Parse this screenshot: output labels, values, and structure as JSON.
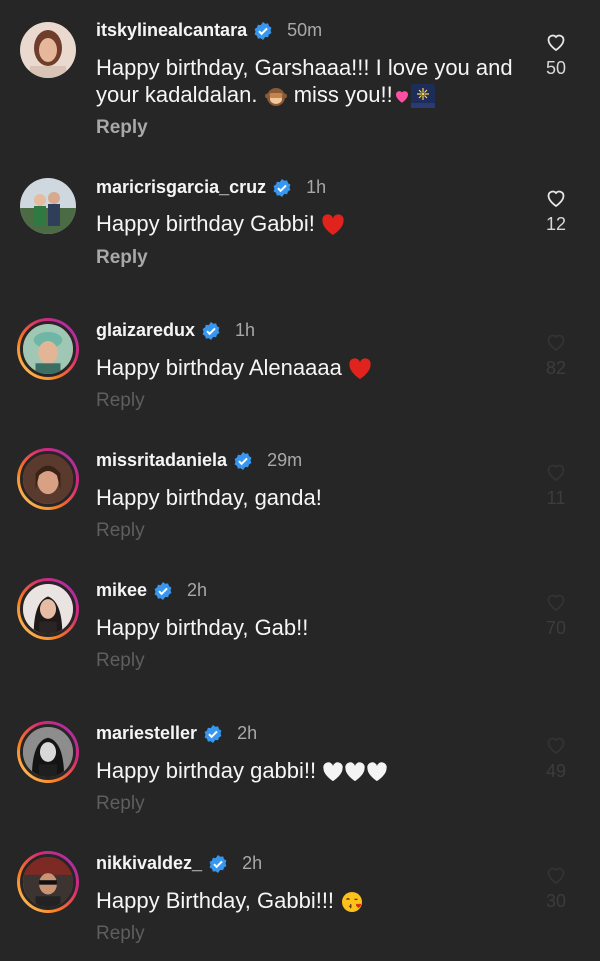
{
  "colors": {
    "background": "#262626",
    "verified": "#3797f0",
    "heart_red": "#e0241d"
  },
  "comments": [
    {
      "username": "itskylinealcantara",
      "time": "50m",
      "text": "Happy birthday, Garshaaa!!! I love you and",
      "text2": "your kadaldalan.",
      "text3": "miss you!!",
      "reply": "Reply",
      "likes": "50",
      "emojis": [
        "see-no-evil-monkey",
        "pink-heart",
        "fireworks-night"
      ]
    },
    {
      "username": "maricrisgarcia_cruz",
      "time": "1h",
      "text": "Happy birthday Gabbi!",
      "reply": "Reply",
      "likes": "12",
      "emojis": [
        "red-heart"
      ]
    },
    {
      "username": "glaizaredux",
      "time": "1h",
      "text": "Happy birthday Alenaaaa",
      "reply": "Reply",
      "likes": "82",
      "emojis": [
        "red-heart"
      ]
    },
    {
      "username": "missritadaniela",
      "time": "29m",
      "text": "Happy birthday, ganda!",
      "reply": "Reply",
      "likes": "11"
    },
    {
      "username": "mikee",
      "time": "2h",
      "text": "Happy birthday, Gab!!",
      "reply": "Reply",
      "likes": "70"
    },
    {
      "username": "mariesteller",
      "time": "2h",
      "text": "Happy birthday gabbi!!",
      "reply": "Reply",
      "likes": "49",
      "emojis": [
        "white-heart",
        "white-heart",
        "white-heart"
      ]
    },
    {
      "username": "nikkivaldez_",
      "time": "2h",
      "text": "Happy Birthday, Gabbi!!!",
      "reply": "Reply",
      "likes": "30",
      "emojis": [
        "face-blowing-kiss"
      ]
    }
  ]
}
